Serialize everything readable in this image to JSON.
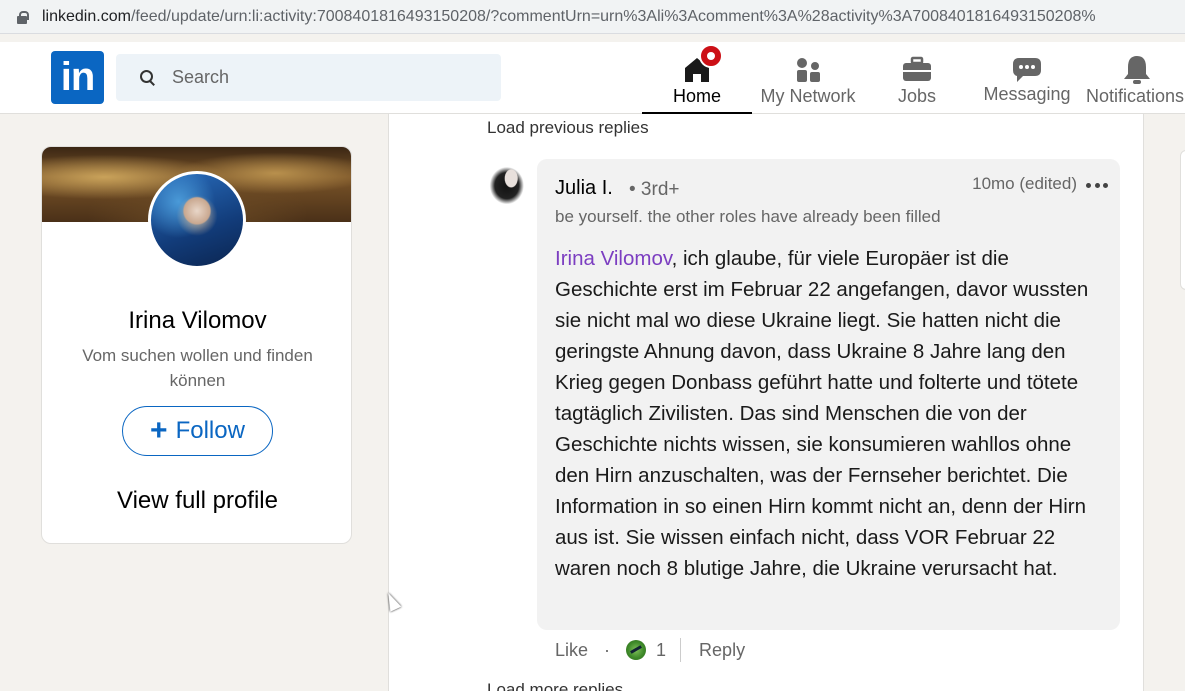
{
  "browser": {
    "url_host": "linkedin.com",
    "url_path": "/feed/update/urn:li:activity:7008401816493150208/?commentUrn=urn%3Ali%3Acomment%3A%28activity%3A7008401816493150208%"
  },
  "nav": {
    "logo": "in",
    "search_placeholder": "Search",
    "items": [
      {
        "label": "Home",
        "icon": "home-icon"
      },
      {
        "label": "My Network",
        "icon": "network-icon"
      },
      {
        "label": "Jobs",
        "icon": "briefcase-icon"
      },
      {
        "label": "Messaging",
        "icon": "messaging-icon"
      },
      {
        "label": "Notifications",
        "icon": "bell-icon"
      }
    ]
  },
  "profile": {
    "name": "Irina Vilomov",
    "headline": "Vom suchen wollen und finden können",
    "follow_label": "Follow",
    "view_profile_label": "View full profile"
  },
  "thread": {
    "load_previous": "Load previous replies",
    "load_more": "Load more replies",
    "comment": {
      "author": "Julia I.",
      "degree": "• 3rd+",
      "time": "10mo (edited)",
      "headline": "be yourself. the other roles have already been filled",
      "mention": "Irina Vilomov",
      "body": ", ich glaube, für viele Europäer ist die Geschichte erst im Februar 22 angefangen, davor wussten sie nicht mal wo diese Ukraine liegt. Sie hatten nicht die geringste Ahnung davon, dass Ukraine 8 Jahre lang den Krieg gegen Donbass geführt hatte und folterte und tötete tagtäglich Zivilisten. Das sind Menschen die von der Geschichte nichts wissen, sie konsumieren wahllos ohne den Hirn anzuschalten, was der Fernseher berichtet. Die Information in so einen Hirn kommt nicht an, denn der Hirn aus ist. Sie wissen einfach nicht, dass VOR Februar 22 waren noch 8 blutige Jahre, die Ukraine verursacht hat.",
      "like_label": "Like",
      "separator": "·",
      "reaction_count": "1",
      "reply_label": "Reply"
    }
  },
  "colors": {
    "brand": "#0a66c2",
    "mention": "#7c3ec1",
    "notification_badge": "#cc1016"
  }
}
